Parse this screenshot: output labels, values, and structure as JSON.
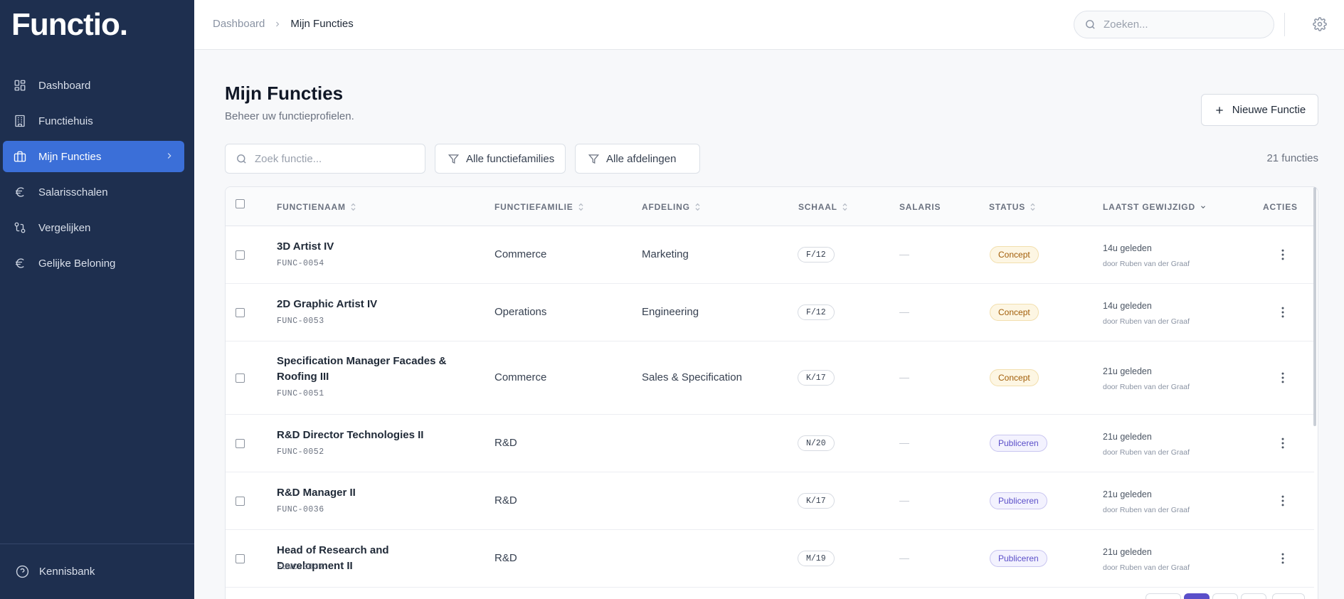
{
  "app": {
    "logo": "Functio."
  },
  "sidebar": {
    "items": [
      {
        "label": "Dashboard",
        "icon": "layout-grid-icon",
        "active": false
      },
      {
        "label": "Functiehuis",
        "icon": "building-icon",
        "active": false
      },
      {
        "label": "Mijn Functies",
        "icon": "briefcase-icon",
        "active": true
      },
      {
        "label": "Salarisschalen",
        "icon": "euro-icon",
        "active": false
      },
      {
        "label": "Vergelijken",
        "icon": "git-compare-icon",
        "active": false
      },
      {
        "label": "Gelijke Beloning",
        "icon": "euro-icon",
        "active": false
      }
    ],
    "bottom": {
      "label": "Kennisbank",
      "icon": "help-circle-icon"
    }
  },
  "topbar": {
    "breadcrumb": {
      "parent": "Dashboard",
      "current": "Mijn Functies"
    },
    "search_placeholder": "Zoeken...",
    "settings_icon": "gear-icon"
  },
  "page": {
    "title": "Mijn Functies",
    "subtitle": "Beheer uw functieprofielen.",
    "new_button": "Nieuwe Functie"
  },
  "filters": {
    "search_placeholder": "Zoek functie...",
    "family": "Alle functiefamilies",
    "department": "Alle afdelingen",
    "count": "21 functies"
  },
  "table": {
    "columns": {
      "name": "FUNCTIENAAM",
      "family": "FUNCTIEFAMILIE",
      "department": "AFDELING",
      "scale": "SCHAAL",
      "salary": "SALARIS",
      "status": "STATUS",
      "modified": "LAATST GEWIJZIGD",
      "actions": "ACTIES"
    },
    "rows": [
      {
        "name": "3D Artist IV",
        "code": "FUNC-0054",
        "family": "Commerce",
        "department": "Marketing",
        "scale": "F/12",
        "salary": "—",
        "status": "Concept",
        "time": "14u geleden",
        "by": "door Ruben van der Graaf"
      },
      {
        "name": "2D Graphic Artist IV",
        "code": "FUNC-0053",
        "family": "Operations",
        "department": "Engineering",
        "scale": "F/12",
        "salary": "—",
        "status": "Concept",
        "time": "14u geleden",
        "by": "door Ruben van der Graaf"
      },
      {
        "name": "Specification Manager Facades & Roofing III",
        "code": "FUNC-0051",
        "family": "Commerce",
        "department": "Sales & Specification",
        "scale": "K/17",
        "salary": "—",
        "status": "Concept",
        "time": "21u geleden",
        "by": "door Ruben van der Graaf"
      },
      {
        "name": "R&D Director Technologies II",
        "code": "FUNC-0052",
        "family": "R&D",
        "department": "",
        "scale": "N/20",
        "salary": "—",
        "status": "Publiceren",
        "time": "21u geleden",
        "by": "door Ruben van der Graaf"
      },
      {
        "name": "R&D Manager II",
        "code": "FUNC-0036",
        "family": "R&D",
        "department": "",
        "scale": "K/17",
        "salary": "—",
        "status": "Publiceren",
        "time": "21u geleden",
        "by": "door Ruben van der Graaf"
      },
      {
        "name": "Head of Research and Development II",
        "code": "FUNC-0037",
        "family": "R&D",
        "department": "",
        "scale": "M/19",
        "salary": "—",
        "status": "Publiceren",
        "time": "21u geleden",
        "by": "door Ruben van der Graaf"
      }
    ]
  },
  "colors": {
    "sidebar_bg": "#1e2f4f",
    "active_nav": "#3b6fd8",
    "concept_badge": "#a15c07",
    "publish_badge": "#5b4fc9"
  }
}
